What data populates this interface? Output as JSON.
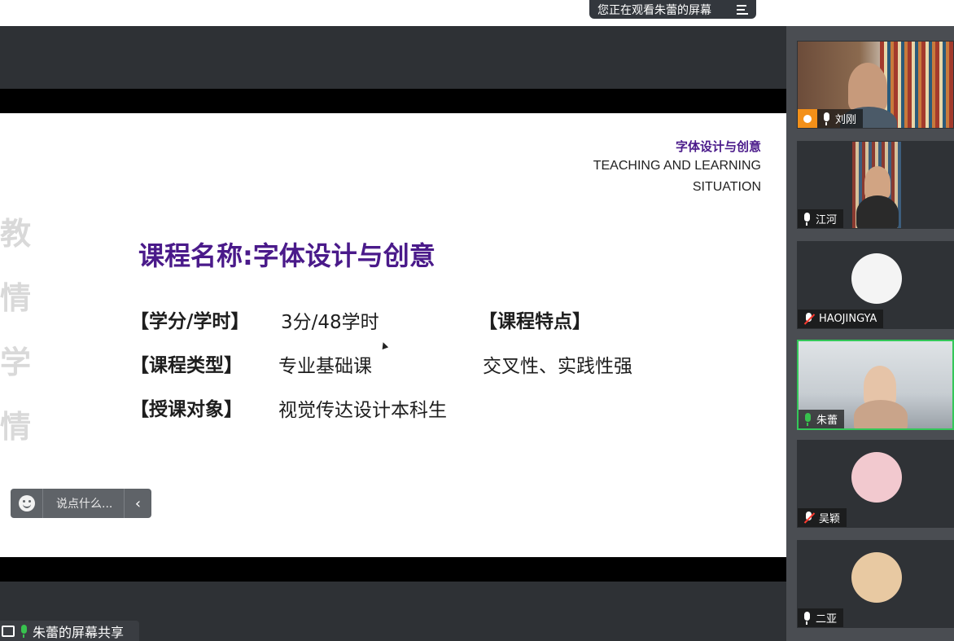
{
  "header": {
    "watching_text": "您正在观看朱蕾的屏幕"
  },
  "slide": {
    "brand_cn": "字体设计与创意",
    "brand_en_line1": "TEACHING AND LEARNING",
    "brand_en_line2": "SITUATION",
    "side_chars": [
      "教",
      "情",
      "学",
      "情"
    ],
    "course_title": "课程名称:字体设计与创意",
    "rows": [
      {
        "label": "【学分/学时】",
        "value": "3分/48学时"
      },
      {
        "label": "【课程类型】",
        "value": "专业基础课"
      },
      {
        "label": "【授课对象】",
        "value": "视觉传达设计本科生"
      }
    ],
    "feature_label": "【课程特点】",
    "feature_value": "交叉性、实践性强"
  },
  "chat": {
    "placeholder": "说点什么...",
    "collapse_icon": "chevron-left-icon"
  },
  "share": {
    "label": "朱蕾的屏幕共享"
  },
  "participants": [
    {
      "name": "刘刚",
      "mic": "on",
      "host": true,
      "video": true
    },
    {
      "name": "江河",
      "mic": "on",
      "host": false,
      "video": true
    },
    {
      "name": "HAOJINGYA",
      "mic": "off",
      "host": false,
      "video": false
    },
    {
      "name": "朱蕾",
      "mic": "on",
      "host": false,
      "video": true,
      "active": true
    },
    {
      "name": "吴颖",
      "mic": "off",
      "host": false,
      "video": false
    },
    {
      "name": "二亚",
      "mic": "on",
      "host": false,
      "video": false
    }
  ],
  "colors": {
    "accent_purple": "#4a1a8a",
    "active_green": "#34c759",
    "host_orange": "#f39019",
    "mute_red": "#ff3b30"
  }
}
